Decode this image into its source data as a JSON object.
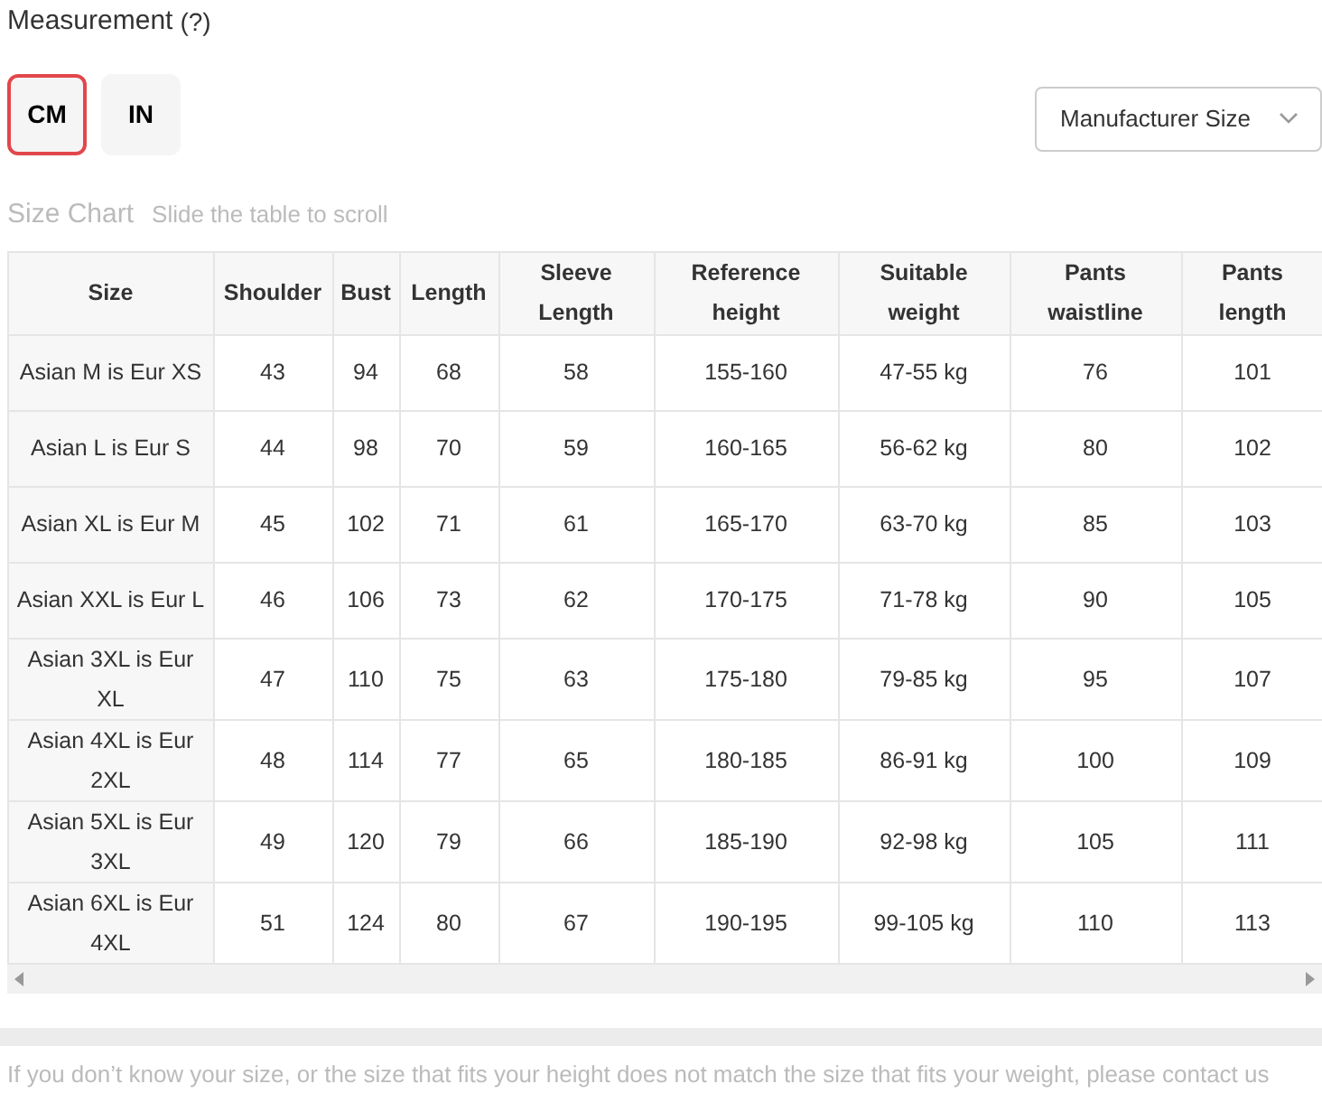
{
  "measurement": {
    "label": "Measurement",
    "help": "(?)"
  },
  "units": [
    {
      "label": "CM",
      "selected": true
    },
    {
      "label": "IN",
      "selected": false
    }
  ],
  "size_system": {
    "value": "Manufacturer Size"
  },
  "size_chart": {
    "title": "Size Chart",
    "hint": "Slide the table to scroll"
  },
  "table": {
    "columns": [
      "Size",
      "Shoulder",
      "Bust",
      "Length",
      "Sleeve Length",
      "Reference height",
      "Suitable weight",
      "Pants waistline",
      "Pants length"
    ],
    "rows": [
      [
        "Asian M is Eur XS",
        "43",
        "94",
        "68",
        "58",
        "155-160",
        "47-55 kg",
        "76",
        "101"
      ],
      [
        "Asian L is Eur S",
        "44",
        "98",
        "70",
        "59",
        "160-165",
        "56-62 kg",
        "80",
        "102"
      ],
      [
        "Asian XL is Eur M",
        "45",
        "102",
        "71",
        "61",
        "165-170",
        "63-70 kg",
        "85",
        "103"
      ],
      [
        "Asian XXL is Eur L",
        "46",
        "106",
        "73",
        "62",
        "170-175",
        "71-78 kg",
        "90",
        "105"
      ],
      [
        "Asian 3XL is Eur XL",
        "47",
        "110",
        "75",
        "63",
        "175-180",
        "79-85 kg",
        "95",
        "107"
      ],
      [
        "Asian 4XL is Eur 2XL",
        "48",
        "114",
        "77",
        "65",
        "180-185",
        "86-91 kg",
        "100",
        "109"
      ],
      [
        "Asian 5XL is Eur 3XL",
        "49",
        "120",
        "79",
        "66",
        "185-190",
        "92-98 kg",
        "105",
        "111"
      ],
      [
        "Asian 6XL is Eur 4XL",
        "51",
        "124",
        "80",
        "67",
        "190-195",
        "99-105 kg",
        "110",
        "113"
      ]
    ]
  },
  "footer_note": "If you don’t know your size, or the size that fits your height does not match the size that fits your weight, please contact us"
}
